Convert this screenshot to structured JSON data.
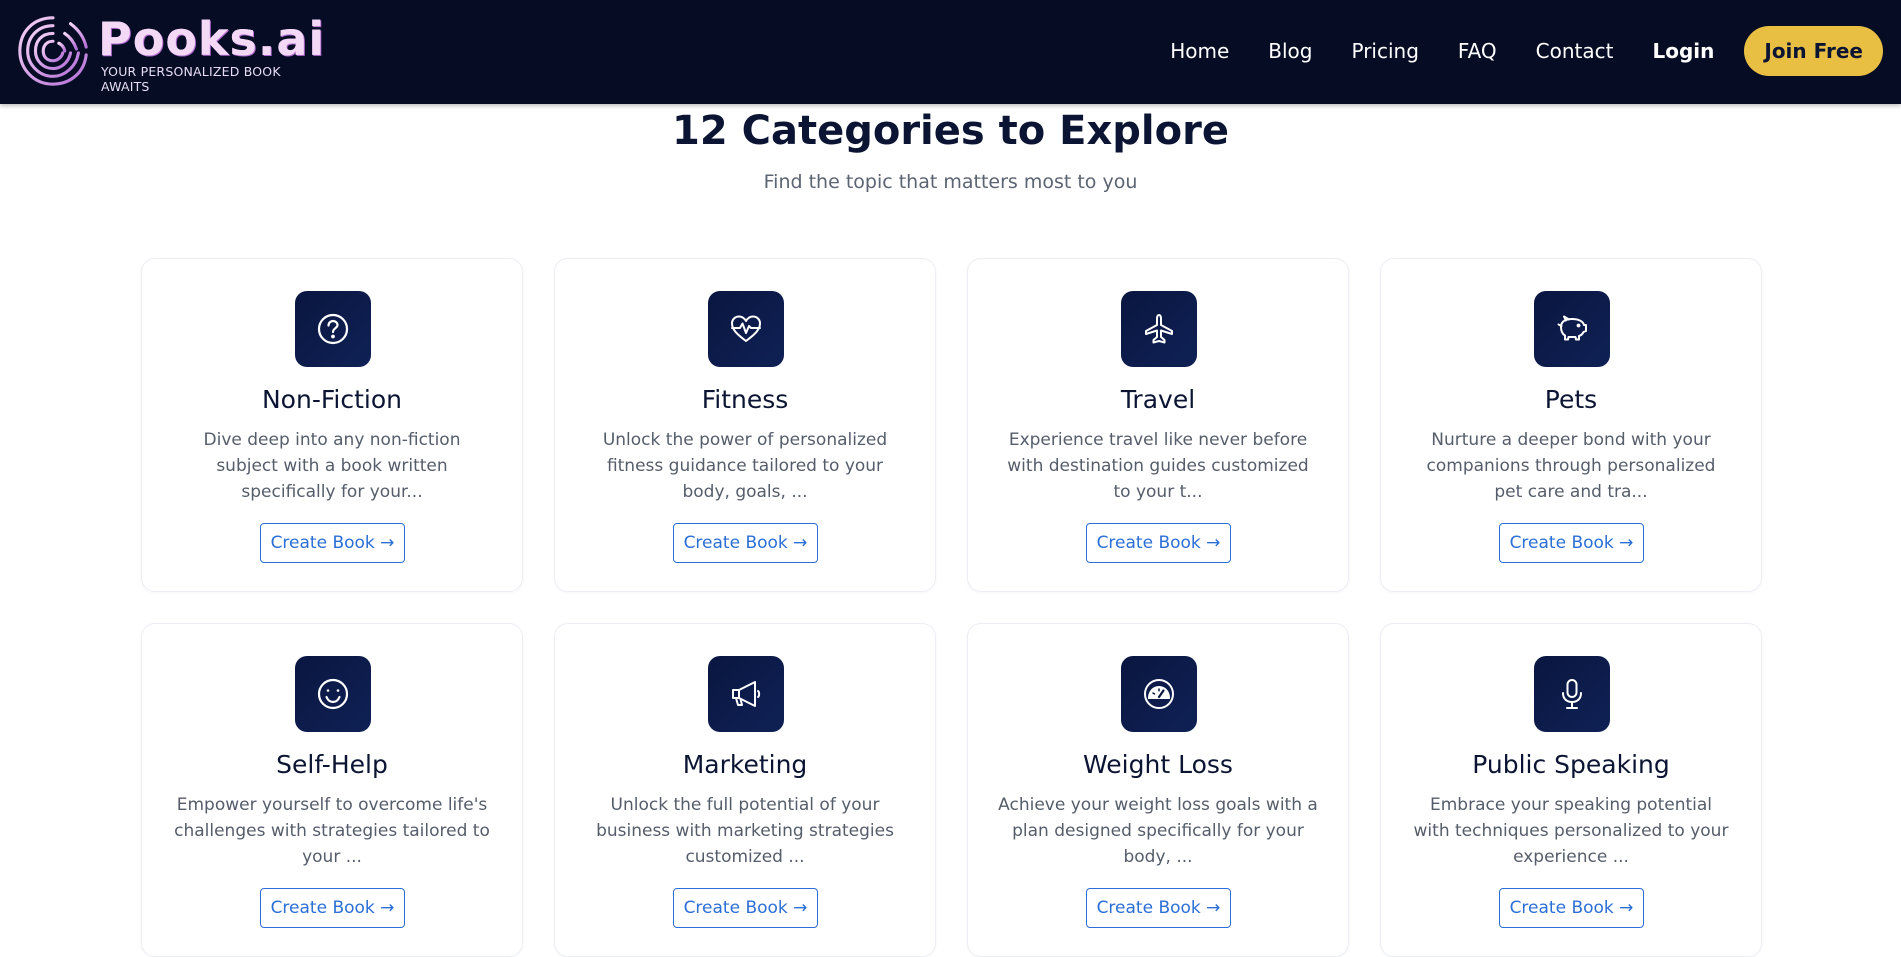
{
  "header": {
    "logo_name": "Pooks.ai",
    "logo_tagline": "YOUR PERSONALIZED BOOK AWAITS",
    "nav": [
      "Home",
      "Blog",
      "Pricing",
      "FAQ",
      "Contact"
    ],
    "login_label": "Login",
    "join_label": "Join Free"
  },
  "colors": {
    "header_bg": "#050c24",
    "accent": "#e9bf43",
    "icon_bg": "#0a1640",
    "link": "#2b6fd6"
  },
  "section": {
    "title": "12 Categories to Explore",
    "subtitle": "Find the topic that matters most to you"
  },
  "categories": [
    {
      "title": "Non-Fiction",
      "icon": "question-circle-icon",
      "description": "Dive deep into any non-fiction subject with a book written specifically for your...",
      "button": "Create Book →"
    },
    {
      "title": "Fitness",
      "icon": "heart-pulse-icon",
      "description": "Unlock the power of personalized fitness guidance tailored to your body, goals, ...",
      "button": "Create Book →"
    },
    {
      "title": "Travel",
      "icon": "airplane-icon",
      "description": "Experience travel like never before with destination guides customized to your t...",
      "button": "Create Book →"
    },
    {
      "title": "Pets",
      "icon": "piggy-icon",
      "description": "Nurture a deeper bond with your companions through personalized pet care and tra...",
      "button": "Create Book →"
    },
    {
      "title": "Self-Help",
      "icon": "smile-icon",
      "description": "Empower yourself to overcome life's challenges with strategies tailored to your ...",
      "button": "Create Book →"
    },
    {
      "title": "Marketing",
      "icon": "megaphone-icon",
      "description": "Unlock the full potential of your business with marketing strategies customized ...",
      "button": "Create Book →"
    },
    {
      "title": "Weight Loss",
      "icon": "speedometer-icon",
      "description": "Achieve your weight loss goals with a plan designed specifically for your body, ...",
      "button": "Create Book →"
    },
    {
      "title": "Public Speaking",
      "icon": "microphone-icon",
      "description": "Embrace your speaking potential with techniques personalized to your experience ...",
      "button": "Create Book →"
    }
  ]
}
